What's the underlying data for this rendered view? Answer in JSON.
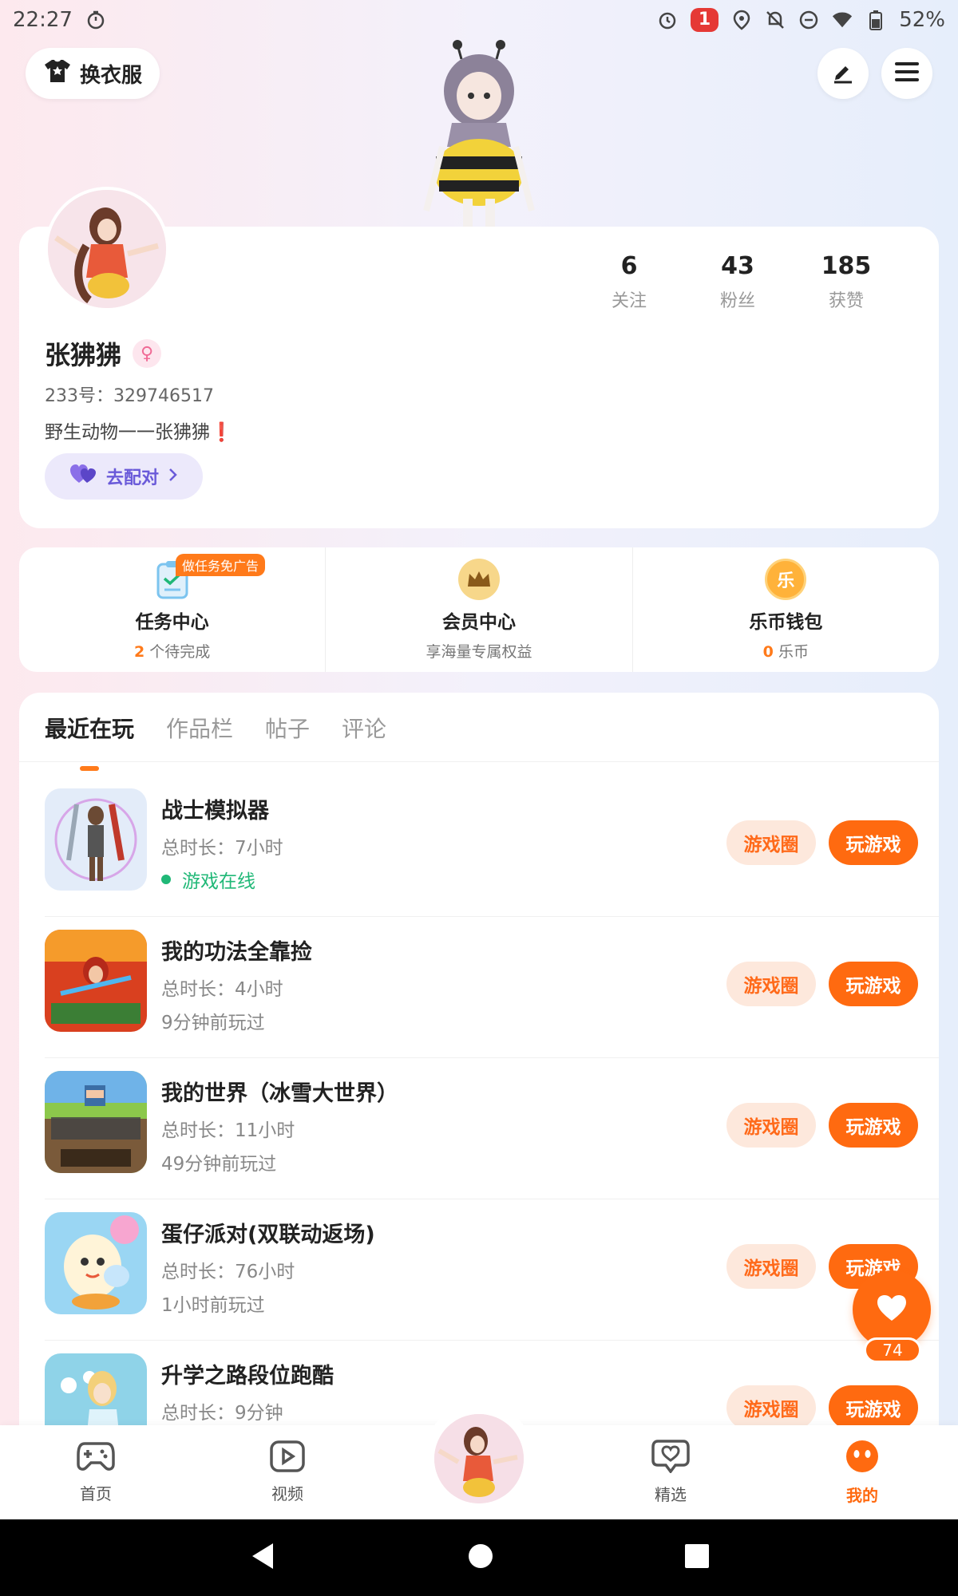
{
  "status_bar": {
    "time": "22:27",
    "notification_count": "1",
    "battery": "52%"
  },
  "header": {
    "outfit_label": "换衣服"
  },
  "profile": {
    "stats": [
      {
        "value": "6",
        "label": "关注"
      },
      {
        "value": "43",
        "label": "粉丝"
      },
      {
        "value": "185",
        "label": "获赞"
      }
    ],
    "username": "张狒狒",
    "gender_symbol": "♀",
    "user_id": "233号：329746517",
    "bio": "野生动物一一张狒狒❗",
    "match_label": "去配对"
  },
  "services": [
    {
      "title": "任务中心",
      "count": "2",
      "sub": " 个待完成",
      "tag": "做任务免广告"
    },
    {
      "title": "会员中心",
      "sub": "享海量专属权益"
    },
    {
      "title": "乐币钱包",
      "count": "0",
      "sub": " 乐币",
      "icon_text": "乐"
    }
  ],
  "tabs": [
    "最近在玩",
    "作品栏",
    "帖子",
    "评论"
  ],
  "games": [
    {
      "name": "战士模拟器",
      "duration": "总时长：7小时",
      "status": "游戏在线",
      "online": true,
      "circle": "游戏圈",
      "play": "玩游戏",
      "icon_color": "#dfe8f7"
    },
    {
      "name": "我的功法全靠捡",
      "duration": "总时长：4小时",
      "status": "9分钟前玩过",
      "online": false,
      "circle": "游戏圈",
      "play": "玩游戏",
      "icon_color": "#d9401f"
    },
    {
      "name": "我的世界（冰雪大世界）",
      "duration": "总时长：11小时",
      "status": "49分钟前玩过",
      "online": false,
      "circle": "游戏圈",
      "play": "玩游戏",
      "icon_color": "#6a8a3a"
    },
    {
      "name": "蛋仔派对(双联动返场)",
      "duration": "总时长：76小时",
      "status": "1小时前玩过",
      "online": false,
      "circle": "游戏圈",
      "play": "玩游戏",
      "icon_color": "#7ec8ef"
    },
    {
      "name": "升学之路段位跑酷",
      "duration": "总时长：9分钟",
      "status": "",
      "online": false,
      "circle": "游戏圈",
      "play": "玩游戏",
      "icon_color": "#8fd3e8"
    }
  ],
  "like_fab": {
    "count": "74"
  },
  "bottom_nav": [
    {
      "label": "首页",
      "icon": "gamepad-icon"
    },
    {
      "label": "视频",
      "icon": "video-icon"
    },
    {
      "label": "",
      "icon": "avatar-center"
    },
    {
      "label": "精选",
      "icon": "heart-chat-icon"
    },
    {
      "label": "我的",
      "icon": "smile-icon"
    }
  ],
  "colors": {
    "accent": "#ff6a10",
    "online": "#20b877",
    "match": "#6a5ad9"
  }
}
